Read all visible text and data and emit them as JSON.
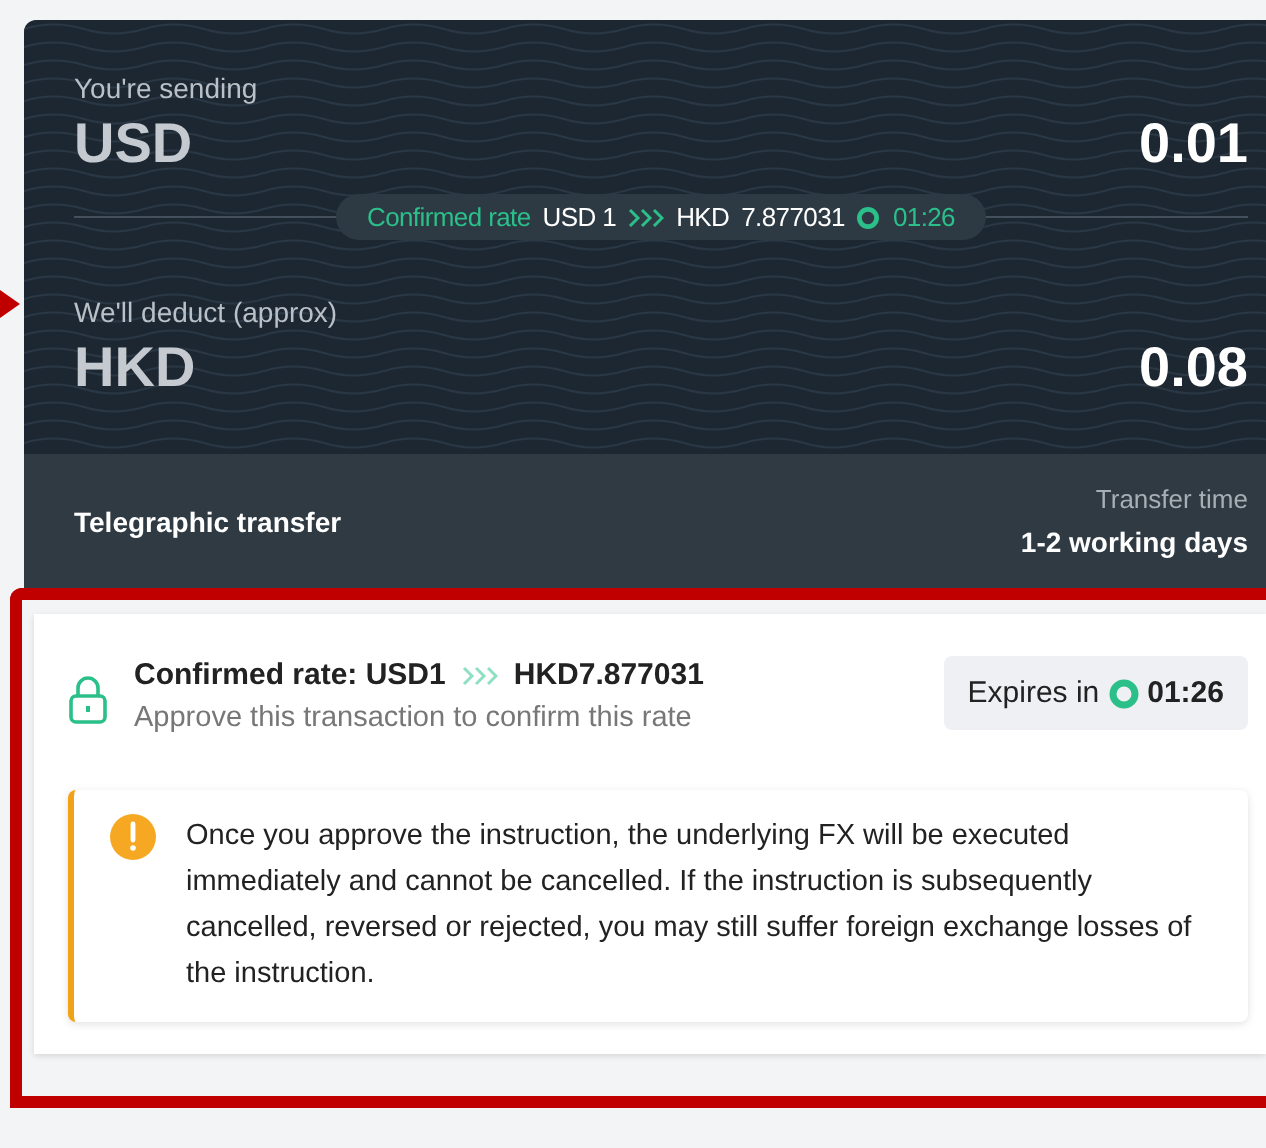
{
  "transfer_summary": {
    "sending_label": "You're sending",
    "sending_currency": "USD",
    "sending_amount": "0.01",
    "rate_pill": {
      "label": "Confirmed rate",
      "from": "USD 1",
      "to_currency": "HKD",
      "rate": "7.877031",
      "timer": "01:26"
    },
    "deduct_label": "We'll deduct (approx)",
    "deduct_currency": "HKD",
    "deduct_amount": "0.08",
    "method": "Telegraphic transfer",
    "time_label": "Transfer time",
    "time_value": "1-2 working days"
  },
  "rate_confirmation": {
    "title_from": "Confirmed rate: USD1",
    "title_to": "HKD7.877031",
    "subtitle": "Approve this transaction to confirm this rate",
    "expires_label": "Expires in",
    "expires_time": "01:26"
  },
  "warning": {
    "text": "Once you approve the instruction, the underlying FX will be executed immediately and cannot be cancelled. If the instruction is subsequently cancelled, reversed or rejected, you may still suffer foreign exchange losses of the instruction."
  }
}
